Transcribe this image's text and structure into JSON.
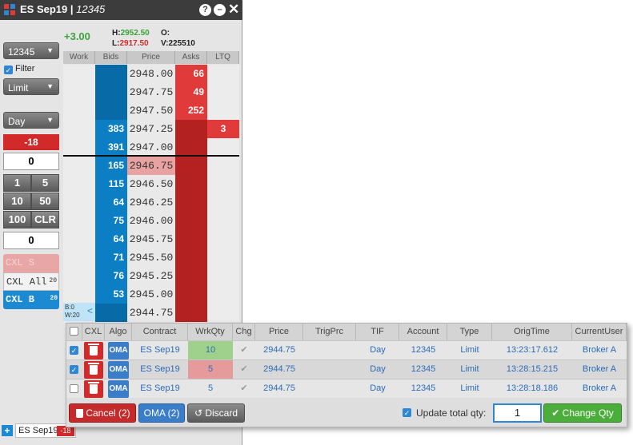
{
  "window": {
    "title": "ES Sep19 | ",
    "title_account": "12345",
    "help_icon": "?",
    "min_icon": "–",
    "close_icon": "✕"
  },
  "top_stats": {
    "change": "+3.00",
    "high_label": "H:",
    "high": "2952.50",
    "low_label": "L:",
    "low": "2917.50",
    "open_label": "O:",
    "open": "",
    "volume_label": "V:",
    "volume": "225510"
  },
  "left_panel": {
    "account": "12345",
    "filter_label": "Filter",
    "order_type": "Limit",
    "tif": "Day",
    "position": "-18",
    "qty_value": "0",
    "qty_buttons": [
      "1",
      "5",
      "10",
      "50",
      "100",
      "CLR"
    ],
    "qty_value_2": "0",
    "cxl_s": "CXL S",
    "cxl_all": "CXL All",
    "cxl_all_count": "20",
    "cxl_b": "CXL B",
    "cxl_b_count": "20"
  },
  "ladder": {
    "headers": [
      "Work",
      "Bids",
      "Price",
      "Asks",
      "LTQ"
    ],
    "rows": [
      {
        "bid": "",
        "price": "2948.00",
        "ask": "66",
        "ltq": ""
      },
      {
        "bid": "",
        "price": "2947.75",
        "ask": "49",
        "ltq": ""
      },
      {
        "bid": "",
        "price": "2947.50",
        "ask": "252",
        "ltq": ""
      },
      {
        "bid": "383",
        "price": "2947.25",
        "ask": "",
        "ltq": "3"
      },
      {
        "bid": "391",
        "price": "2947.00",
        "ask": "",
        "ltq": ""
      },
      {
        "bid": "165",
        "price": "2946.75",
        "ask": "",
        "ltq": ""
      },
      {
        "bid": "115",
        "price": "2946.50",
        "ask": "",
        "ltq": ""
      },
      {
        "bid": "64",
        "price": "2946.25",
        "ask": "",
        "ltq": ""
      },
      {
        "bid": "75",
        "price": "2946.00",
        "ask": "",
        "ltq": ""
      },
      {
        "bid": "64",
        "price": "2945.75",
        "ask": "",
        "ltq": ""
      },
      {
        "bid": "71",
        "price": "2945.50",
        "ask": "",
        "ltq": ""
      },
      {
        "bid": "76",
        "price": "2945.25",
        "ask": "",
        "ltq": ""
      },
      {
        "bid": "53",
        "price": "2945.00",
        "ask": "",
        "ltq": ""
      },
      {
        "bid": "",
        "price": "2944.75",
        "ask": "",
        "ltq": ""
      }
    ],
    "work_b": "B:0",
    "work_w": "W:20",
    "collapse_icon": "<"
  },
  "orders": {
    "headers": [
      "",
      "CXL",
      "Algo",
      "Contract",
      "WrkQty",
      "Chg",
      "Price",
      "TrigPrc",
      "TIF",
      "Account",
      "Type",
      "OrigTime",
      "CurrentUser"
    ],
    "rows": [
      {
        "checked": true,
        "algo": "OMA",
        "contract": "ES Sep19",
        "wrkqty": "10",
        "price": "2944.75",
        "trig": "",
        "tif": "Day",
        "account": "12345",
        "type": "Limit",
        "origtime": "13:23:17.612",
        "user": "Broker A",
        "qty_color": "#9fd08c"
      },
      {
        "checked": true,
        "algo": "OMA",
        "contract": "ES Sep19",
        "wrkqty": "5",
        "price": "2944.75",
        "trig": "",
        "tif": "Day",
        "account": "12345",
        "type": "Limit",
        "origtime": "13:28:15.215",
        "user": "Broker A",
        "qty_color": "#e59b9b"
      },
      {
        "checked": false,
        "algo": "OMA",
        "contract": "ES Sep19",
        "wrkqty": "5",
        "price": "2944.75",
        "trig": "",
        "tif": "Day",
        "account": "12345",
        "type": "Limit",
        "origtime": "13:28:18.186",
        "user": "Broker A",
        "qty_color": ""
      }
    ],
    "cancel_label": "Cancel (2)",
    "oma_label": "OMA (2)",
    "discard_label": "Discard",
    "update_total_label": "Update total qty:",
    "total_qty": "1",
    "change_qty_label": "Change Qty"
  },
  "bottom_tab": {
    "label": "ES Sep19",
    "badge": "-18",
    "add_icon": "+"
  }
}
